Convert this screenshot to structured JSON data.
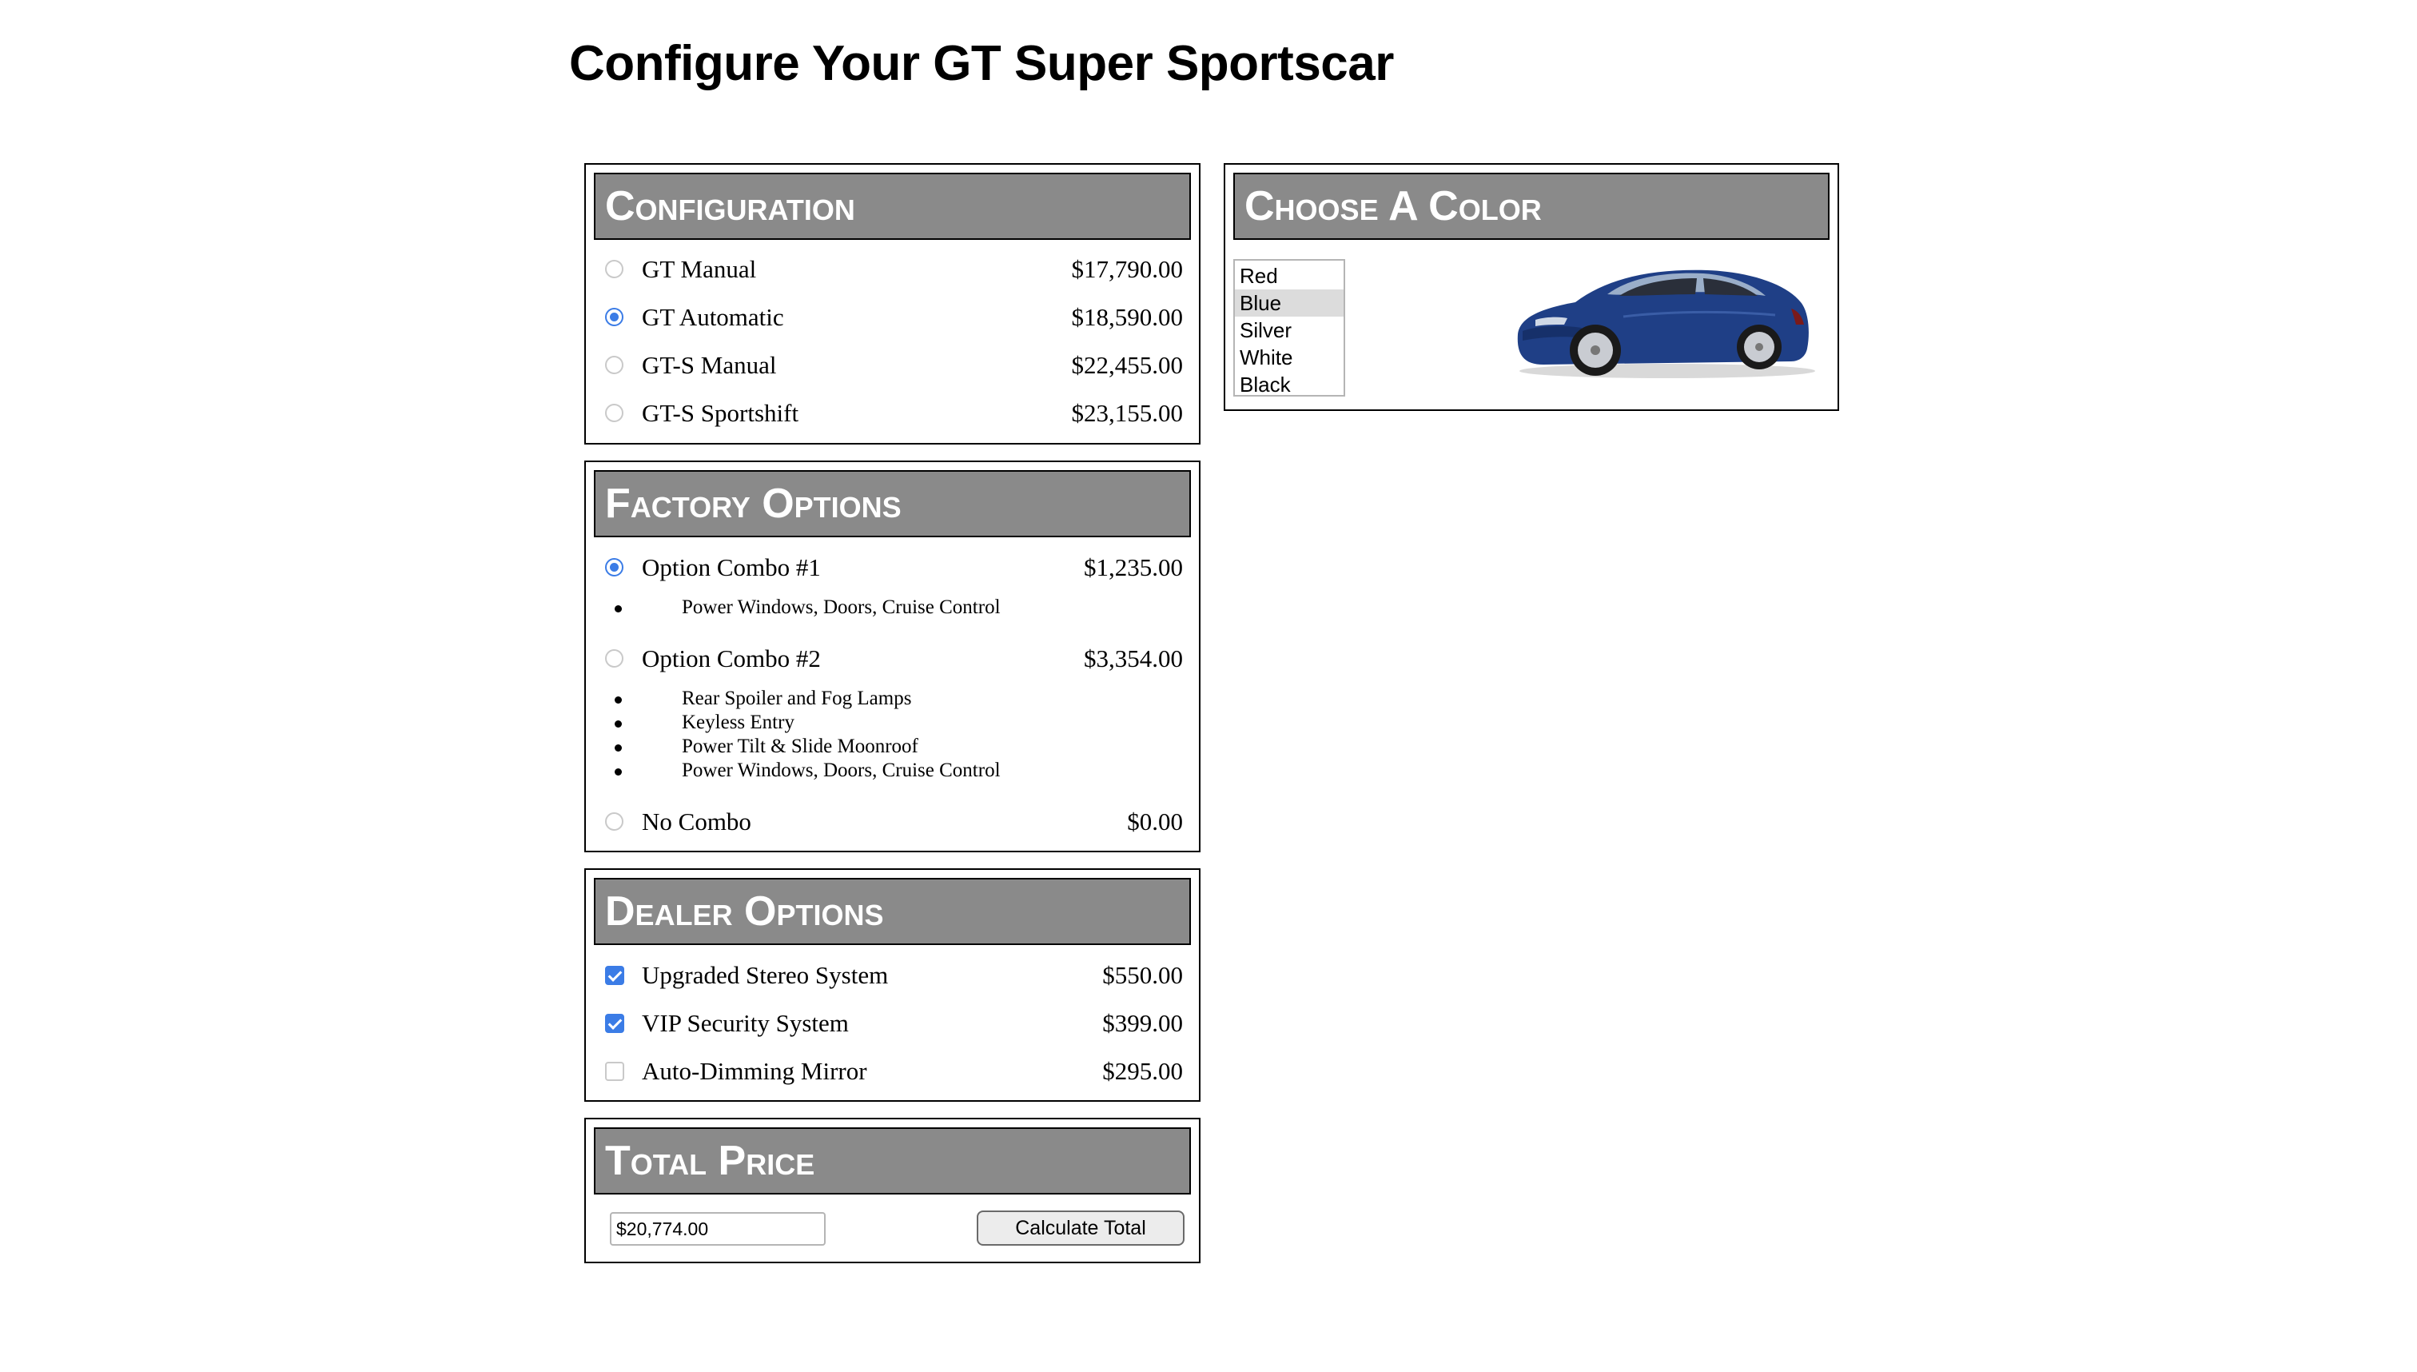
{
  "page": {
    "title": "Configure Your GT Super Sportscar"
  },
  "configuration": {
    "heading": "Configuration",
    "options": [
      {
        "label": "GT Manual",
        "price": "$17,790.00",
        "selected": false
      },
      {
        "label": "GT Automatic",
        "price": "$18,590.00",
        "selected": true
      },
      {
        "label": "GT-S Manual",
        "price": "$22,455.00",
        "selected": false
      },
      {
        "label": "GT-S Sportshift",
        "price": "$23,155.00",
        "selected": false
      }
    ]
  },
  "factory_options": {
    "heading": "Factory Options",
    "combos": [
      {
        "label": "Option Combo #1",
        "price": "$1,235.00",
        "selected": true,
        "features": [
          "Power Windows, Doors, Cruise Control"
        ]
      },
      {
        "label": "Option Combo #2",
        "price": "$3,354.00",
        "selected": false,
        "features": [
          "Rear Spoiler and Fog Lamps",
          "Keyless Entry",
          "Power Tilt & Slide Moonroof",
          "Power Windows, Doors, Cruise Control"
        ]
      },
      {
        "label": "No Combo",
        "price": "$0.00",
        "selected": false,
        "features": []
      }
    ]
  },
  "dealer_options": {
    "heading": "Dealer Options",
    "options": [
      {
        "label": "Upgraded Stereo System",
        "price": "$550.00",
        "checked": true
      },
      {
        "label": "VIP Security System",
        "price": "$399.00",
        "checked": true
      },
      {
        "label": "Auto-Dimming Mirror",
        "price": "$295.00",
        "checked": false
      }
    ]
  },
  "total": {
    "heading": "Total Price",
    "value": "$20,774.00",
    "button_label": "Calculate Total"
  },
  "color": {
    "heading": "Choose A Color",
    "options": [
      "Red",
      "Blue",
      "Silver",
      "White",
      "Black"
    ],
    "selected": "Blue",
    "car_image": "blue-sports-coupe-image"
  },
  "colors": {
    "header_bg": "#8a8a8a",
    "accent": "#3b7ce6",
    "car_body": "#1f3f86"
  }
}
